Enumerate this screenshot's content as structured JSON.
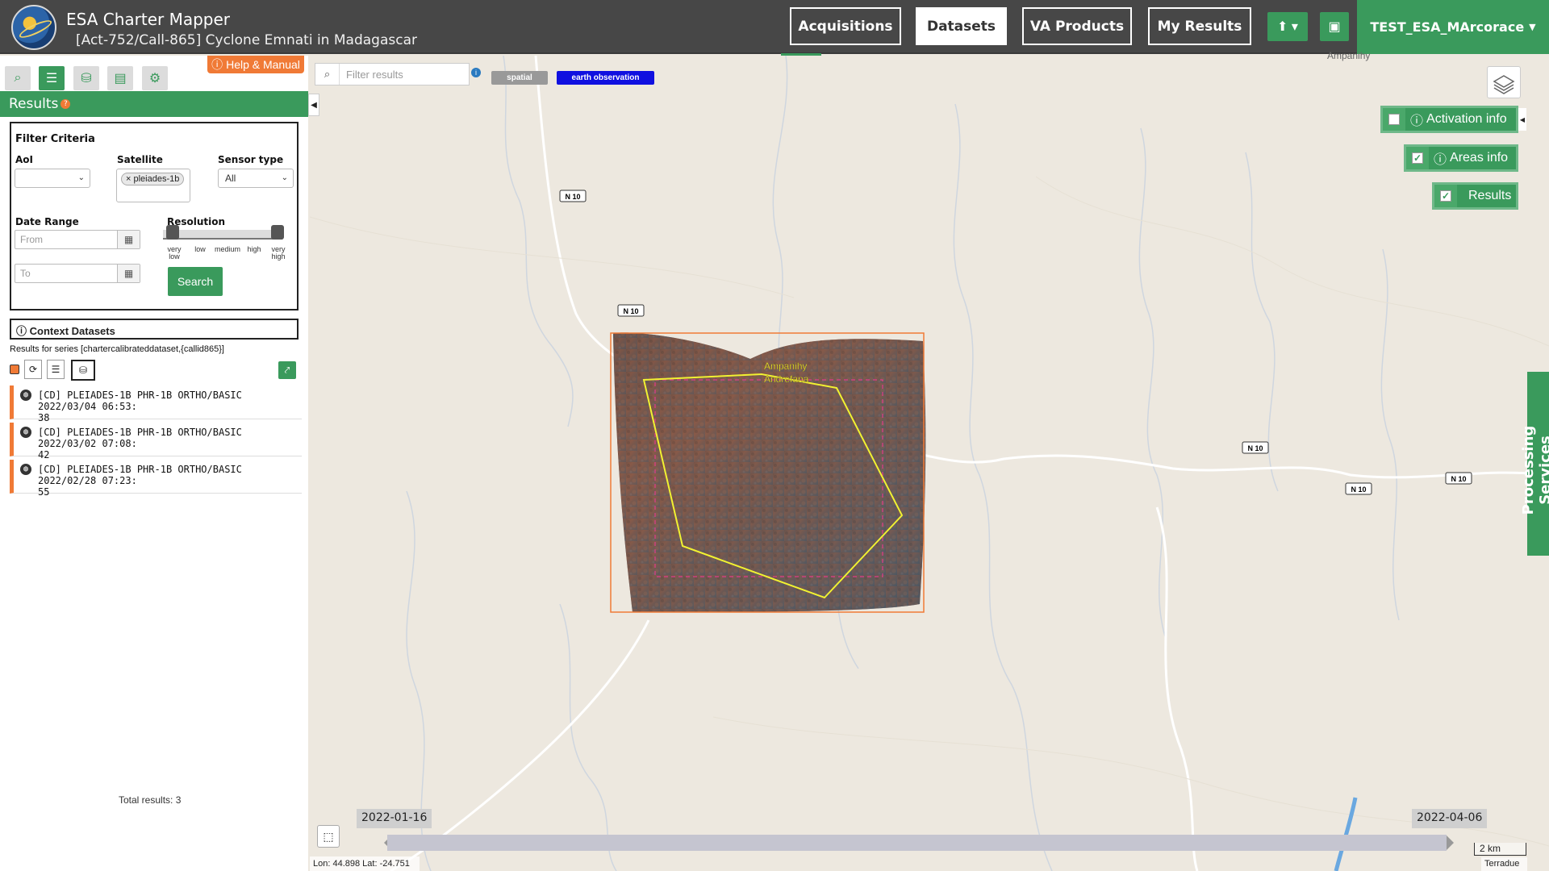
{
  "header": {
    "title": "ESA Charter Mapper",
    "subtitle": "[Act-752/Call-865] Cyclone Emnati in Madagascar",
    "nav": [
      {
        "label": "Acquisitions"
      },
      {
        "label": "Datasets"
      },
      {
        "label": "VA Products"
      },
      {
        "label": "My Results"
      }
    ],
    "upload_icon": "upload-icon",
    "briefcase_icon": "briefcase-icon",
    "user": "TEST_ESA_MArcorace"
  },
  "panel": {
    "help_label": "Help & Manual",
    "results_title": "Results",
    "filter": {
      "title": "Filter Criteria",
      "aoi_label": "AoI",
      "aoi_value": "",
      "satellite_label": "Satellite",
      "satellite_tag": "pleiades-1b",
      "sensor_label": "Sensor type",
      "sensor_value": "All",
      "date_label": "Date Range",
      "from_placeholder": "From",
      "to_placeholder": "To",
      "resolution_label": "Resolution",
      "resolution_levels": [
        "very low",
        "low",
        "medium",
        "high",
        "very high"
      ],
      "search_label": "Search"
    },
    "context_title": "Context Datasets",
    "series_text": "Results for series [chartercalibrateddataset,{callid865}]",
    "results": [
      {
        "line1": "[CD] PLEIADES-1B PHR-1B ORTHO/BASIC 2022/03/04 06:53:",
        "line2": "38"
      },
      {
        "line1": "[CD] PLEIADES-1B PHR-1B ORTHO/BASIC 2022/03/02 07:08:",
        "line2": "42"
      },
      {
        "line1": "[CD] PLEIADES-1B PHR-1B ORTHO/BASIC 2022/02/28 07:23:",
        "line2": "55"
      }
    ],
    "total": "Total results: 3"
  },
  "map": {
    "filter_placeholder": "Filter results",
    "tags": {
      "spatial": "spatial",
      "eo": "earth observation"
    },
    "overlays": {
      "activation": "Activation info",
      "areas": "Areas info",
      "results": "Results"
    },
    "processing": "Processing Services",
    "place_label_1": "Ampanihy",
    "place_label_2": "Andrefana",
    "road_labels": [
      "N 10",
      "N 10",
      "N 10",
      "N 10",
      "N 10"
    ],
    "timeline_start": "2022-01-16",
    "timeline_end": "2022-04-06",
    "scale": "2 km",
    "attribution": "Terradue",
    "coords": "Lon: 44.898 Lat: -24.751",
    "top_label": "Ampanihy"
  },
  "colors": {
    "brand_green": "#3a9a5c",
    "accent_orange": "#f07a36",
    "header_bg": "#474747",
    "aoi_yellow": "#f2f231",
    "footprint_orange": "#f07a36",
    "eo_tag_blue": "#1010e0"
  }
}
